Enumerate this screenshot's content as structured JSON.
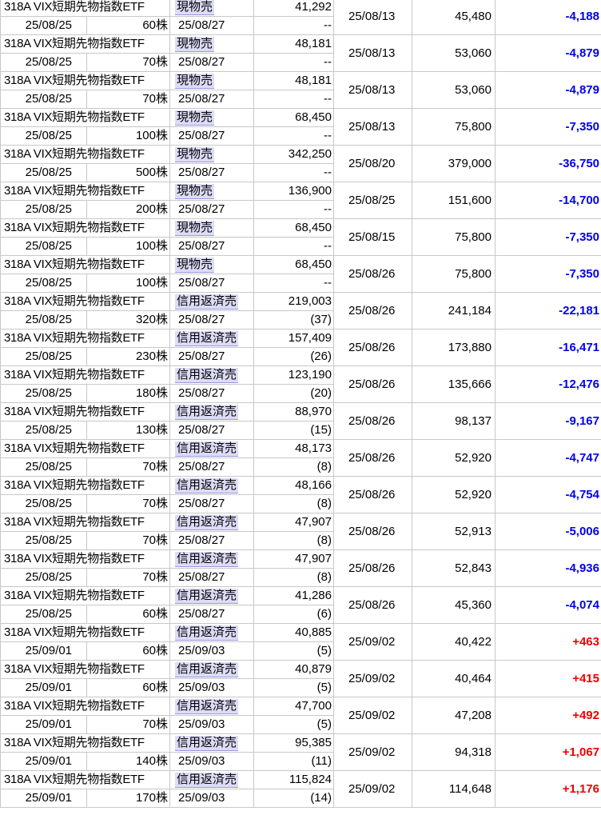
{
  "table": {
    "rows": [
      {
        "name": "318A VIX短期先物指数ETF",
        "type": "現物売",
        "price": "41,292",
        "sub": "--",
        "trade_date": "25/08/25",
        "qty": "60株",
        "settle_date": "25/08/27",
        "cost_date": "25/08/13",
        "amount": "45,480",
        "pl": "-4,188",
        "pl_sign": "neg"
      },
      {
        "name": "318A VIX短期先物指数ETF",
        "type": "現物売",
        "price": "48,181",
        "sub": "--",
        "trade_date": "25/08/25",
        "qty": "70株",
        "settle_date": "25/08/27",
        "cost_date": "25/08/13",
        "amount": "53,060",
        "pl": "-4,879",
        "pl_sign": "neg"
      },
      {
        "name": "318A VIX短期先物指数ETF",
        "type": "現物売",
        "price": "48,181",
        "sub": "--",
        "trade_date": "25/08/25",
        "qty": "70株",
        "settle_date": "25/08/27",
        "cost_date": "25/08/13",
        "amount": "53,060",
        "pl": "-4,879",
        "pl_sign": "neg"
      },
      {
        "name": "318A VIX短期先物指数ETF",
        "type": "現物売",
        "price": "68,450",
        "sub": "--",
        "trade_date": "25/08/25",
        "qty": "100株",
        "settle_date": "25/08/27",
        "cost_date": "25/08/13",
        "amount": "75,800",
        "pl": "-7,350",
        "pl_sign": "neg"
      },
      {
        "name": "318A VIX短期先物指数ETF",
        "type": "現物売",
        "price": "342,250",
        "sub": "--",
        "trade_date": "25/08/25",
        "qty": "500株",
        "settle_date": "25/08/27",
        "cost_date": "25/08/20",
        "amount": "379,000",
        "pl": "-36,750",
        "pl_sign": "neg"
      },
      {
        "name": "318A VIX短期先物指数ETF",
        "type": "現物売",
        "price": "136,900",
        "sub": "--",
        "trade_date": "25/08/25",
        "qty": "200株",
        "settle_date": "25/08/27",
        "cost_date": "25/08/25",
        "amount": "151,600",
        "pl": "-14,700",
        "pl_sign": "neg"
      },
      {
        "name": "318A VIX短期先物指数ETF",
        "type": "現物売",
        "price": "68,450",
        "sub": "--",
        "trade_date": "25/08/25",
        "qty": "100株",
        "settle_date": "25/08/27",
        "cost_date": "25/08/15",
        "amount": "75,800",
        "pl": "-7,350",
        "pl_sign": "neg"
      },
      {
        "name": "318A VIX短期先物指数ETF",
        "type": "現物売",
        "price": "68,450",
        "sub": "--",
        "trade_date": "25/08/25",
        "qty": "100株",
        "settle_date": "25/08/27",
        "cost_date": "25/08/26",
        "amount": "75,800",
        "pl": "-7,350",
        "pl_sign": "neg"
      },
      {
        "name": "318A VIX短期先物指数ETF",
        "type": "信用返済売",
        "price": "219,003",
        "sub": "(37)",
        "trade_date": "25/08/25",
        "qty": "320株",
        "settle_date": "25/08/27",
        "cost_date": "25/08/26",
        "amount": "241,184",
        "pl": "-22,181",
        "pl_sign": "neg"
      },
      {
        "name": "318A VIX短期先物指数ETF",
        "type": "信用返済売",
        "price": "157,409",
        "sub": "(26)",
        "trade_date": "25/08/25",
        "qty": "230株",
        "settle_date": "25/08/27",
        "cost_date": "25/08/26",
        "amount": "173,880",
        "pl": "-16,471",
        "pl_sign": "neg"
      },
      {
        "name": "318A VIX短期先物指数ETF",
        "type": "信用返済売",
        "price": "123,190",
        "sub": "(20)",
        "trade_date": "25/08/25",
        "qty": "180株",
        "settle_date": "25/08/27",
        "cost_date": "25/08/26",
        "amount": "135,666",
        "pl": "-12,476",
        "pl_sign": "neg"
      },
      {
        "name": "318A VIX短期先物指数ETF",
        "type": "信用返済売",
        "price": "88,970",
        "sub": "(15)",
        "trade_date": "25/08/25",
        "qty": "130株",
        "settle_date": "25/08/27",
        "cost_date": "25/08/26",
        "amount": "98,137",
        "pl": "-9,167",
        "pl_sign": "neg"
      },
      {
        "name": "318A VIX短期先物指数ETF",
        "type": "信用返済売",
        "price": "48,173",
        "sub": "(8)",
        "trade_date": "25/08/25",
        "qty": "70株",
        "settle_date": "25/08/27",
        "cost_date": "25/08/26",
        "amount": "52,920",
        "pl": "-4,747",
        "pl_sign": "neg"
      },
      {
        "name": "318A VIX短期先物指数ETF",
        "type": "信用返済売",
        "price": "48,166",
        "sub": "(8)",
        "trade_date": "25/08/25",
        "qty": "70株",
        "settle_date": "25/08/27",
        "cost_date": "25/08/26",
        "amount": "52,920",
        "pl": "-4,754",
        "pl_sign": "neg"
      },
      {
        "name": "318A VIX短期先物指数ETF",
        "type": "信用返済売",
        "price": "47,907",
        "sub": "(8)",
        "trade_date": "25/08/25",
        "qty": "70株",
        "settle_date": "25/08/27",
        "cost_date": "25/08/26",
        "amount": "52,913",
        "pl": "-5,006",
        "pl_sign": "neg"
      },
      {
        "name": "318A VIX短期先物指数ETF",
        "type": "信用返済売",
        "price": "47,907",
        "sub": "(8)",
        "trade_date": "25/08/25",
        "qty": "70株",
        "settle_date": "25/08/27",
        "cost_date": "25/08/26",
        "amount": "52,843",
        "pl": "-4,936",
        "pl_sign": "neg"
      },
      {
        "name": "318A VIX短期先物指数ETF",
        "type": "信用返済売",
        "price": "41,286",
        "sub": "(6)",
        "trade_date": "25/08/25",
        "qty": "60株",
        "settle_date": "25/08/27",
        "cost_date": "25/08/26",
        "amount": "45,360",
        "pl": "-4,074",
        "pl_sign": "neg"
      },
      {
        "name": "318A VIX短期先物指数ETF",
        "type": "信用返済売",
        "price": "40,885",
        "sub": "(5)",
        "trade_date": "25/09/01",
        "qty": "60株",
        "settle_date": "25/09/03",
        "cost_date": "25/09/02",
        "amount": "40,422",
        "pl": "+463",
        "pl_sign": "pos"
      },
      {
        "name": "318A VIX短期先物指数ETF",
        "type": "信用返済売",
        "price": "40,879",
        "sub": "(5)",
        "trade_date": "25/09/01",
        "qty": "60株",
        "settle_date": "25/09/03",
        "cost_date": "25/09/02",
        "amount": "40,464",
        "pl": "+415",
        "pl_sign": "pos"
      },
      {
        "name": "318A VIX短期先物指数ETF",
        "type": "信用返済売",
        "price": "47,700",
        "sub": "(5)",
        "trade_date": "25/09/01",
        "qty": "70株",
        "settle_date": "25/09/03",
        "cost_date": "25/09/02",
        "amount": "47,208",
        "pl": "+492",
        "pl_sign": "pos"
      },
      {
        "name": "318A VIX短期先物指数ETF",
        "type": "信用返済売",
        "price": "95,385",
        "sub": "(11)",
        "trade_date": "25/09/01",
        "qty": "140株",
        "settle_date": "25/09/03",
        "cost_date": "25/09/02",
        "amount": "94,318",
        "pl": "+1,067",
        "pl_sign": "pos"
      },
      {
        "name": "318A VIX短期先物指数ETF",
        "type": "信用返済売",
        "price": "115,824",
        "sub": "(14)",
        "trade_date": "25/09/01",
        "qty": "170株",
        "settle_date": "25/09/03",
        "cost_date": "25/09/02",
        "amount": "114,648",
        "pl": "+1,176",
        "pl_sign": "pos"
      }
    ]
  },
  "colors": {
    "negative": "#0000ee",
    "positive": "#ee0000",
    "type_highlight": "#dcdcf8",
    "grid": "#c8c8c8"
  }
}
